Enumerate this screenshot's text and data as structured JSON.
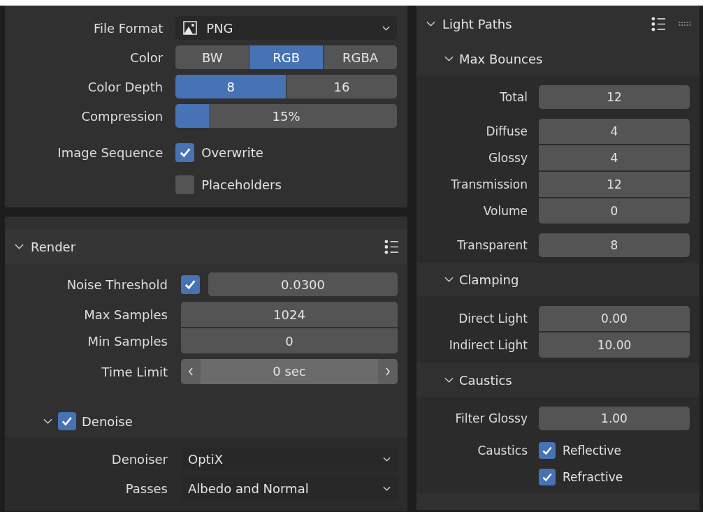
{
  "panels": [
    {
      "sections": [
        {
          "kind": "plain",
          "rows": [
            {
              "kind": "format_dropdown",
              "label": "File Format",
              "value": "PNG"
            },
            {
              "kind": "segmented",
              "label": "Color",
              "options": [
                {
                  "label": "BW",
                  "selected": false
                },
                {
                  "label": "RGB",
                  "selected": true
                },
                {
                  "label": "RGBA",
                  "selected": false
                }
              ]
            },
            {
              "kind": "segmented",
              "label": "Color Depth",
              "options": [
                {
                  "label": "8",
                  "selected": true
                },
                {
                  "label": "16",
                  "selected": false
                }
              ]
            },
            {
              "kind": "slider",
              "label": "Compression",
              "value": "15%",
              "level": 0.15
            },
            {
              "kind": "checkbox",
              "label": "Image Sequence",
              "text": "Overwrite",
              "checked": true
            },
            {
              "kind": "checkbox",
              "text": "Placeholders",
              "checked": false
            }
          ]
        }
      ]
    },
    {
      "sections": [
        {
          "kind": "header",
          "title": "Render",
          "drag_handle": false,
          "rows": [
            {
              "kind": "toggle_number",
              "label": "Noise Threshold",
              "checked": true,
              "value": "0.0300"
            },
            {
              "kind": "group",
              "items": [
                {
                  "label": "Max Samples",
                  "value": "1024"
                },
                {
                  "label": "Min Samples",
                  "value": "0"
                }
              ]
            },
            {
              "kind": "stepper",
              "label": "Time Limit",
              "value": "0 sec"
            }
          ]
        },
        {
          "kind": "subheader",
          "title": "Denoise",
          "checked": true,
          "rows": [
            {
              "kind": "dropdown",
              "label": "Denoiser",
              "value": "OptiX"
            },
            {
              "kind": "dropdown",
              "label": "Passes",
              "value": "Albedo and Normal"
            }
          ]
        }
      ]
    },
    {
      "sections": [
        {
          "kind": "header",
          "title": "Light Paths",
          "drag_handle": true
        },
        {
          "kind": "subheader",
          "title": "Max Bounces",
          "rows": [
            {
              "kind": "number",
              "label": "Total",
              "value": "12"
            },
            {
              "kind": "group",
              "items": [
                {
                  "label": "Diffuse",
                  "value": "4"
                },
                {
                  "label": "Glossy",
                  "value": "4"
                },
                {
                  "label": "Transmission",
                  "value": "12"
                },
                {
                  "label": "Volume",
                  "value": "0"
                }
              ]
            },
            {
              "kind": "number",
              "label": "Transparent",
              "value": "8"
            }
          ]
        },
        {
          "kind": "subheader",
          "title": "Clamping",
          "rows": [
            {
              "kind": "group",
              "items": [
                {
                  "label": "Direct Light",
                  "value": "0.00"
                },
                {
                  "label": "Indirect Light",
                  "value": "10.00"
                }
              ]
            }
          ]
        },
        {
          "kind": "subheader",
          "title": "Caustics",
          "rows": [
            {
              "kind": "number",
              "label": "Filter Glossy",
              "value": "1.00"
            },
            {
              "kind": "checkbox",
              "label": "Caustics",
              "text": "Reflective",
              "checked": true
            },
            {
              "kind": "checkbox",
              "text": "Refractive",
              "checked": true
            }
          ]
        }
      ]
    }
  ]
}
